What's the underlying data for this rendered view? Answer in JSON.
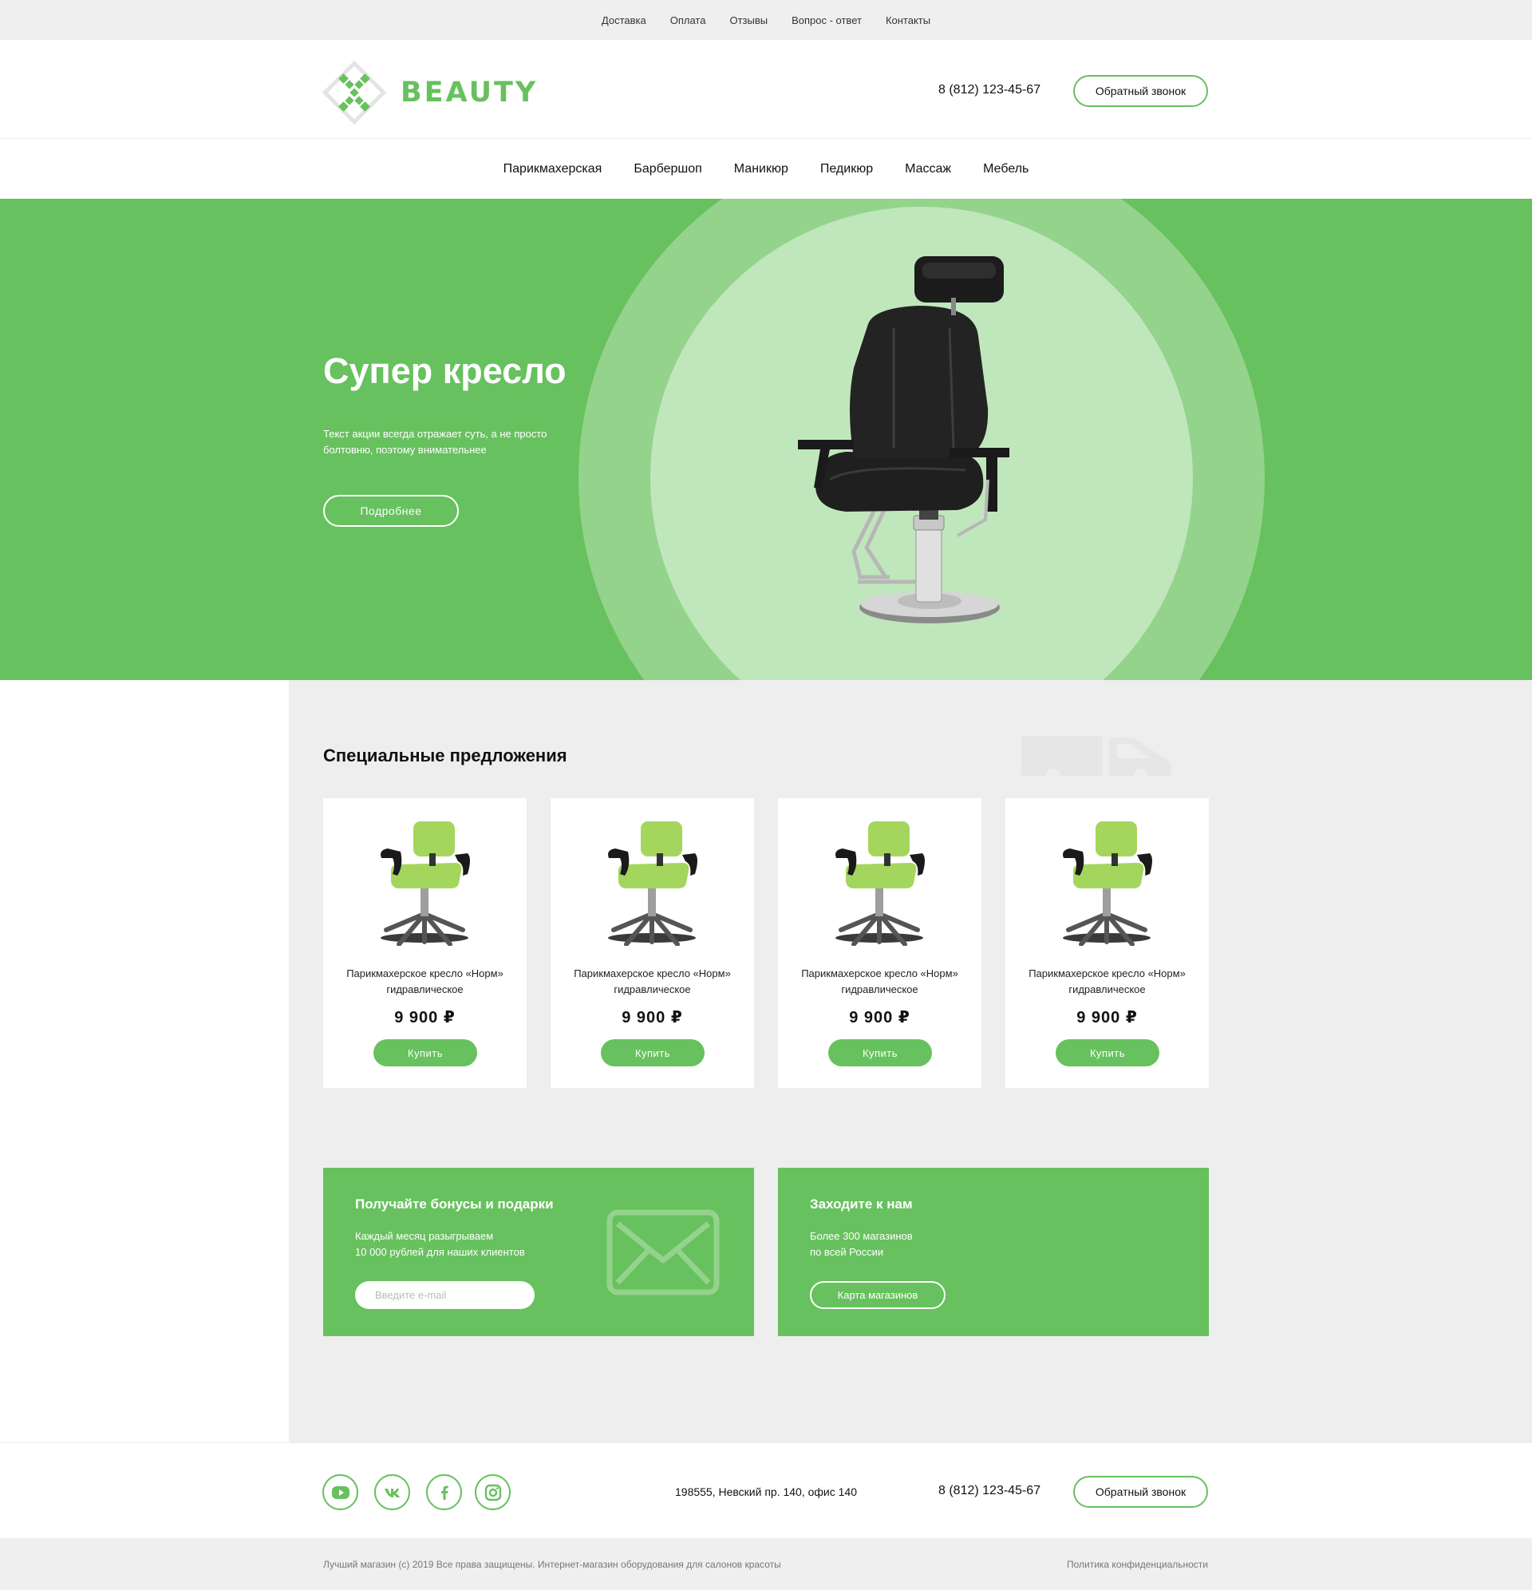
{
  "topbar": {
    "links": [
      "Доставка",
      "Оплата",
      "Отзывы",
      "Вопрос - ответ",
      "Контакты"
    ]
  },
  "header": {
    "logo_text": "BEAUTY",
    "phone": "8 (812) 123-45-67",
    "callback_label": "Обратный звонок"
  },
  "nav": {
    "items": [
      "Парикмахерская",
      "Барбершоп",
      "Маникюр",
      "Педикюр",
      "Массаж",
      "Мебель"
    ]
  },
  "hero": {
    "title": "Супер кресло",
    "text": "Текст акции всегда отражает суть, а не просто болтовню, поэтому внимательнее",
    "button_label": "Подробнее"
  },
  "offers": {
    "title": "Специальные предложения",
    "products": [
      {
        "name": "Парикмахерское кресло «Норм» гидравлическое",
        "price": "9 900 ₽",
        "button": "Купить"
      },
      {
        "name": "Парикмахерское кресло «Норм» гидравлическое",
        "price": "9 900 ₽",
        "button": "Купить"
      },
      {
        "name": "Парикмахерское кресло «Норм» гидравлическое",
        "price": "9 900 ₽",
        "button": "Купить"
      },
      {
        "name": "Парикмахерское кресло «Норм» гидравлическое",
        "price": "9 900 ₽",
        "button": "Купить"
      }
    ]
  },
  "promo_bonus": {
    "title": "Получайте бонусы и подарки",
    "line1": "Каждый месяц разыгрываем",
    "line2": "10 000 рублей для наших клиентов",
    "email_placeholder": "Введите e-mail",
    "icon": "envelope-icon"
  },
  "promo_stores": {
    "title": "Заходите к нам",
    "line1": "Более 300 магазинов",
    "line2": "по всей России",
    "button_label": "Карта магазинов"
  },
  "footer": {
    "social_icons": [
      "youtube-icon",
      "vk-icon",
      "facebook-icon",
      "instagram-icon"
    ],
    "address": "198555, Невский пр. 140, офис 140",
    "phone": "8 (812) 123-45-67",
    "callback_label": "Обратный звонок",
    "copyright": "Лучший магазин (с) 2019 Все права защищены. Интернет-магазин оборудования для салонов красоты",
    "policy": "Политика конфиденциальности"
  },
  "colors": {
    "accent": "#67c15e",
    "hero_circle_outer": "#94d38c",
    "hero_circle_inner": "#c0e7bb",
    "section_bg": "#eeeeee"
  }
}
